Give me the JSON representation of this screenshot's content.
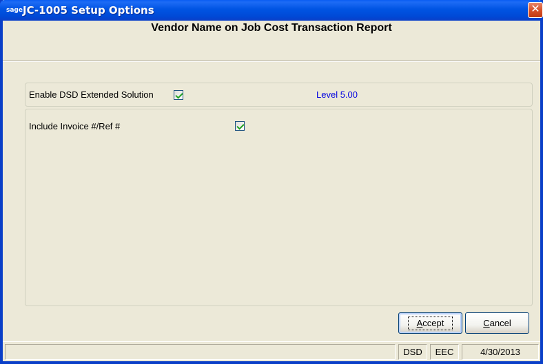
{
  "window": {
    "icon_text": "sage",
    "title": "JC-1005 Setup Options",
    "close_symbol": "✕"
  },
  "heading": "Vendor Name on Job Cost Transaction Report",
  "options": {
    "enable_label": "Enable DSD Extended Solution",
    "enable_checked": true,
    "level_text": "Level  5.00",
    "include_label": "Include Invoice #/Ref #",
    "include_checked": true
  },
  "buttons": {
    "accept_label": "Accept",
    "cancel_label": "Cancel"
  },
  "statusbar": {
    "main": "",
    "pane1": "DSD",
    "pane2": "EEC",
    "date": "4/30/2013"
  },
  "colors": {
    "titlebar": "#0054e3",
    "level_text": "#0000e0",
    "checkmark": "#21a121"
  }
}
